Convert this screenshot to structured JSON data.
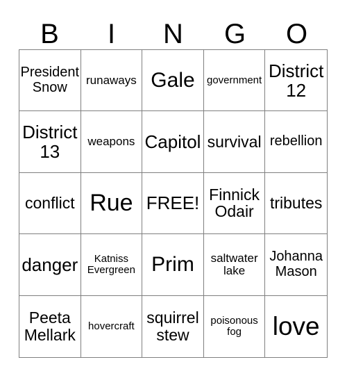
{
  "card": {
    "header_letters": [
      "B",
      "I",
      "N",
      "G",
      "O"
    ],
    "colors": {
      "border": "#7f7f7f",
      "cell_background": "#ffffff",
      "text": "#000000",
      "page_background": "#ffffff"
    },
    "grid": {
      "columns": 5,
      "rows": 5,
      "free_space_label": "FREE!",
      "free_space_position": {
        "row": 3,
        "column": 3
      }
    },
    "cells": [
      {
        "text": "President Snow",
        "size": "xs"
      },
      {
        "text": "runaways",
        "size": "xxs"
      },
      {
        "text": "Gale",
        "size": "ml"
      },
      {
        "text": "government",
        "size": "tiny"
      },
      {
        "text": "District 12",
        "size": "md"
      },
      {
        "text": "District 13",
        "size": "md"
      },
      {
        "text": "weapons",
        "size": "xxs"
      },
      {
        "text": "Capitol",
        "size": "md"
      },
      {
        "text": "survival",
        "size": "sm"
      },
      {
        "text": "rebellion",
        "size": "xs"
      },
      {
        "text": "conflict",
        "size": "sm"
      },
      {
        "text": "Rue",
        "size": "lg"
      },
      {
        "text": "FREE!",
        "size": "md"
      },
      {
        "text": "Finnick Odair",
        "size": "sm"
      },
      {
        "text": "tributes",
        "size": "sm"
      },
      {
        "text": "danger",
        "size": "md"
      },
      {
        "text": "Katniss Evergreen",
        "size": "tiny"
      },
      {
        "text": "Prim",
        "size": "ml"
      },
      {
        "text": "saltwater lake",
        "size": "xxs"
      },
      {
        "text": "Johanna Mason",
        "size": "xs"
      },
      {
        "text": "Peeta Mellark",
        "size": "sm"
      },
      {
        "text": "hovercraft",
        "size": "tiny"
      },
      {
        "text": "squirrel stew",
        "size": "sm"
      },
      {
        "text": "poisonous fog",
        "size": "tiny"
      },
      {
        "text": "love",
        "size": "xl"
      }
    ]
  }
}
